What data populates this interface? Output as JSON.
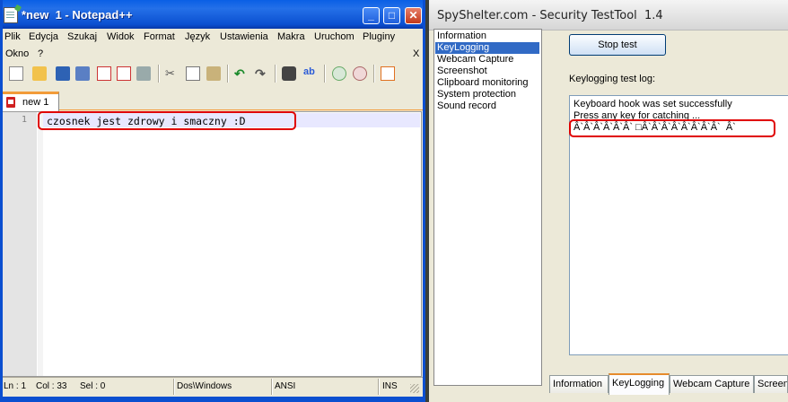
{
  "notepad": {
    "title": "*new  1 - Notepad++",
    "menu_row1": [
      "Plik",
      "Edycja",
      "Szukaj",
      "Widok",
      "Format",
      "Język",
      "Ustawienia",
      "Makra",
      "Uruchom",
      "Pluginy"
    ],
    "menu_row2": [
      "Okno",
      "?"
    ],
    "menu_close": "X",
    "tab_label": "new  1",
    "line_number": "1",
    "line_text": "czosnek jest zdrowy i smaczny :D",
    "status": {
      "ln": "Ln : 1",
      "col": "Col : 33",
      "sel": "Sel : 0",
      "eol": "Dos\\Windows",
      "encoding": "ANSI",
      "mode": "INS"
    }
  },
  "spyshelter": {
    "title": "SpyShelter.com - Security TestTool  1.4",
    "nav_items": [
      "Information",
      "KeyLogging",
      "Webcam Capture",
      "Screenshot",
      "Clipboard monitoring",
      "System protection",
      "Sound record"
    ],
    "selected_nav": "KeyLogging",
    "stop_button": "Stop test",
    "log_label": "Keylogging test log:",
    "log_lines": [
      "Keyboard hook was set successfully",
      "Press any key for catching ...",
      "Â`Â`Â`Â`Â`Â` □Â`Â`Â`Â`Â`Â`Â`Â`  Â`"
    ],
    "tabs": [
      "Information",
      "KeyLogging",
      "Webcam Capture",
      "Screen"
    ],
    "active_tab": "KeyLogging"
  },
  "colors": {
    "xp_title_blue": "#0b4fd0",
    "highlight_red": "#e00000",
    "selection_blue": "#316ac5",
    "tab_accent_orange": "#f29b38"
  }
}
